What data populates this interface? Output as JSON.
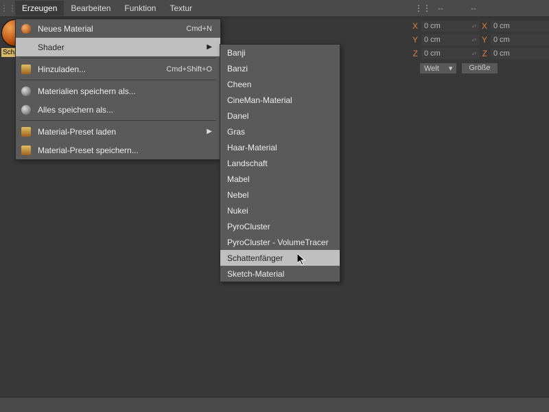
{
  "menubar": {
    "items": [
      "Erzeugen",
      "Bearbeiten",
      "Funktion",
      "Textur"
    ],
    "selected_index": 0
  },
  "right_menubar": {
    "dash1": "--",
    "dash2": "--"
  },
  "material_thumb": {
    "label": "Schattenfänger"
  },
  "dropdown": {
    "items": [
      {
        "label": "Neues Material",
        "accel": "Cmd+N",
        "icon": "new-material-icon",
        "hasSubmenu": false,
        "highlight": false
      },
      {
        "label": "Shader",
        "accel": "",
        "icon": "",
        "hasSubmenu": true,
        "highlight": true
      },
      {
        "sep": true
      },
      {
        "label": "Hinzuladen...",
        "accel": "Cmd+Shift+O",
        "icon": "load-icon",
        "hasSubmenu": false,
        "highlight": false
      },
      {
        "sep": true
      },
      {
        "label": "Materialien speichern als...",
        "accel": "",
        "icon": "save-icon",
        "hasSubmenu": false,
        "highlight": false
      },
      {
        "label": "Alles speichern als...",
        "accel": "",
        "icon": "save-all-icon",
        "hasSubmenu": false,
        "highlight": false
      },
      {
        "sep": true
      },
      {
        "label": "Material-Preset laden",
        "accel": "",
        "icon": "preset-load-icon",
        "hasSubmenu": true,
        "highlight": false
      },
      {
        "label": "Material-Preset speichern...",
        "accel": "",
        "icon": "preset-save-icon",
        "hasSubmenu": false,
        "highlight": false
      }
    ]
  },
  "submenu": {
    "items": [
      "Banji",
      "Banzi",
      "Cheen",
      "CineMan-Material",
      "Danel",
      "Gras",
      "Haar-Material",
      "Landschaft",
      "Mabel",
      "Nebel",
      "Nukei",
      "PyroCluster",
      "PyroCluster - VolumeTracer",
      "Schattenfänger",
      "Sketch-Material"
    ],
    "highlight_index": 13
  },
  "props": {
    "axes": [
      "X",
      "Y",
      "Z"
    ],
    "left_vals": [
      "0 cm",
      "0 cm",
      "0 cm"
    ],
    "right_vals": [
      "0 cm",
      "0 cm",
      "0 cm"
    ],
    "select_label": "Welt",
    "button_label": "Größe"
  }
}
